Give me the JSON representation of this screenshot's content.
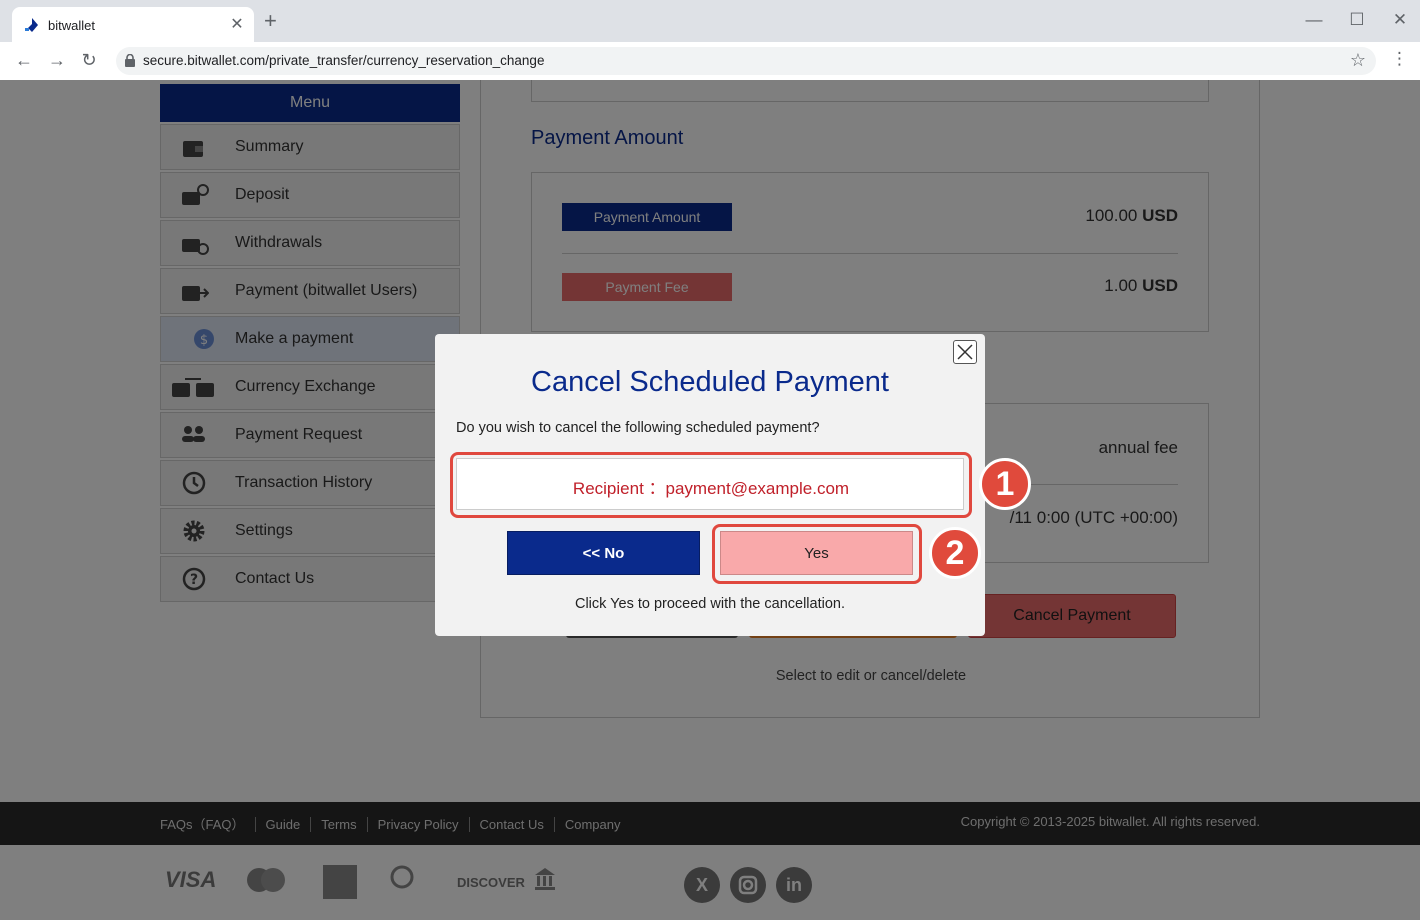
{
  "browser": {
    "tab_title": "bitwallet",
    "tab_close": "✕",
    "new_tab": "+",
    "url": "secure.bitwallet.com/private_transfer/currency_reservation_change"
  },
  "menu": {
    "header": "Menu",
    "items": [
      {
        "label": "Summary",
        "icon": "wallet-icon"
      },
      {
        "label": "Deposit",
        "icon": "deposit-icon"
      },
      {
        "label": "Withdrawals",
        "icon": "withdraw-icon"
      },
      {
        "label": "Payment (bitwallet Users)",
        "icon": "payment-icon"
      },
      {
        "label": "Make a payment",
        "icon": "dollar-icon"
      },
      {
        "label": "Currency Exchange",
        "icon": "exchange-icon"
      },
      {
        "label": "Payment Request",
        "icon": "users-icon"
      },
      {
        "label": "Transaction History",
        "icon": "history-icon"
      },
      {
        "label": "Settings",
        "icon": "gear-icon"
      },
      {
        "label": "Contact Us",
        "icon": "question-icon"
      }
    ]
  },
  "main": {
    "payment_amount_title": "Payment Amount",
    "amount_label": "Payment Amount",
    "amount_value": "100.00",
    "amount_currency": "USD",
    "fee_label": "Payment Fee",
    "fee_value": "1.00",
    "fee_currency": "USD",
    "schedule_fee_text": "annual fee",
    "schedule_date_partial": "/11 0:00 (UTC +00:00)",
    "cancel_payment_button": "Cancel Payment",
    "select_note": "Select to edit or cancel/delete"
  },
  "footer": {
    "links": [
      "FAQs（FAQ）",
      "Guide",
      "Terms",
      "Privacy Policy",
      "Contact Us",
      "Company"
    ],
    "copyright": "Copyright © 2013-2025 bitwallet. All rights reserved.",
    "payment_logos": [
      "VISA",
      "DISCOVER"
    ],
    "social": [
      "X",
      "in"
    ]
  },
  "modal": {
    "title": "Cancel Scheduled Payment",
    "question": "Do you wish to cancel the following scheduled payment?",
    "recipient": "Recipient ：payment@example.com",
    "no_button": "<< No",
    "yes_button": "Yes",
    "note": "Click Yes to proceed with the cancellation."
  },
  "callouts": {
    "one": "1",
    "two": "2",
    "color": "#e0483e"
  },
  "colors": {
    "brand_navy": "#0a2a8c",
    "fee_red": "#e96b6b",
    "yes_pink": "#f9a9aa"
  }
}
